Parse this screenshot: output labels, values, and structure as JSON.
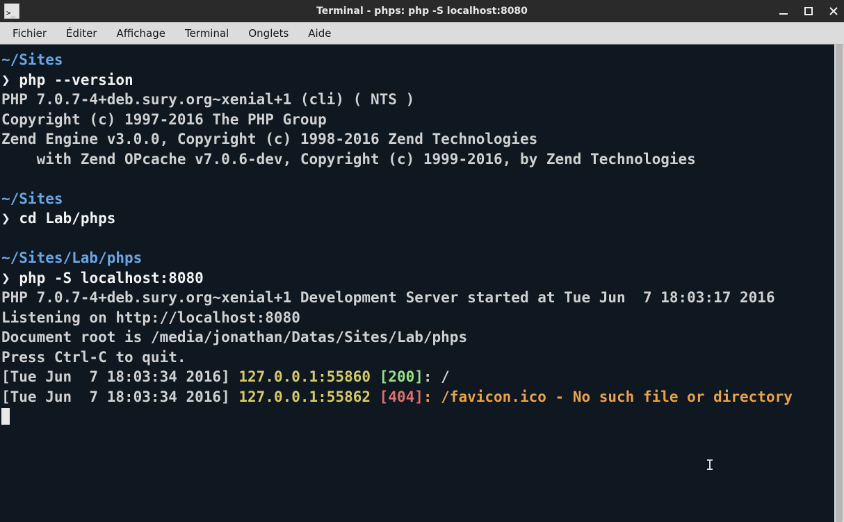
{
  "window": {
    "title": "Terminal - phps: php -S localhost:8080"
  },
  "menu": {
    "items": [
      "Fichier",
      "Éditer",
      "Affichage",
      "Terminal",
      "Onglets",
      "Aide"
    ]
  },
  "terminal": {
    "block1": {
      "path": "~/Sites",
      "prompt": "❯",
      "cmd": "php --version",
      "out1": "PHP 7.0.7-4+deb.sury.org~xenial+1 (cli) ( NTS )",
      "out2": "Copyright (c) 1997-2016 The PHP Group",
      "out3": "Zend Engine v3.0.0, Copyright (c) 1998-2016 Zend Technologies",
      "out4": "    with Zend OPcache v7.0.6-dev, Copyright (c) 1999-2016, by Zend Technologies"
    },
    "block2": {
      "path": "~/Sites",
      "prompt": "❯",
      "cmd": "cd Lab/phps"
    },
    "block3": {
      "path": "~/Sites/Lab/phps",
      "prompt": "❯",
      "cmd": "php -S localhost:8080",
      "out1": "PHP 7.0.7-4+deb.sury.org~xenial+1 Development Server started at Tue Jun  7 18:03:17 2016",
      "out2": "Listening on http://localhost:8080",
      "out3": "Document root is /media/jonathan/Datas/Sites/Lab/phps",
      "out4": "Press Ctrl-C to quit.",
      "log1_ts": "[Tue Jun  7 18:03:34 2016] ",
      "log1_addr": "127.0.0.1:55860 ",
      "log1_code": "[200]",
      "log1_rest": ": /",
      "log2_ts": "[Tue Jun  7 18:03:34 2016] ",
      "log2_addr": "127.0.0.1:55862 ",
      "log2_code": "[404]",
      "log2_rest": ": /favicon.ico - No such file or directory"
    }
  }
}
